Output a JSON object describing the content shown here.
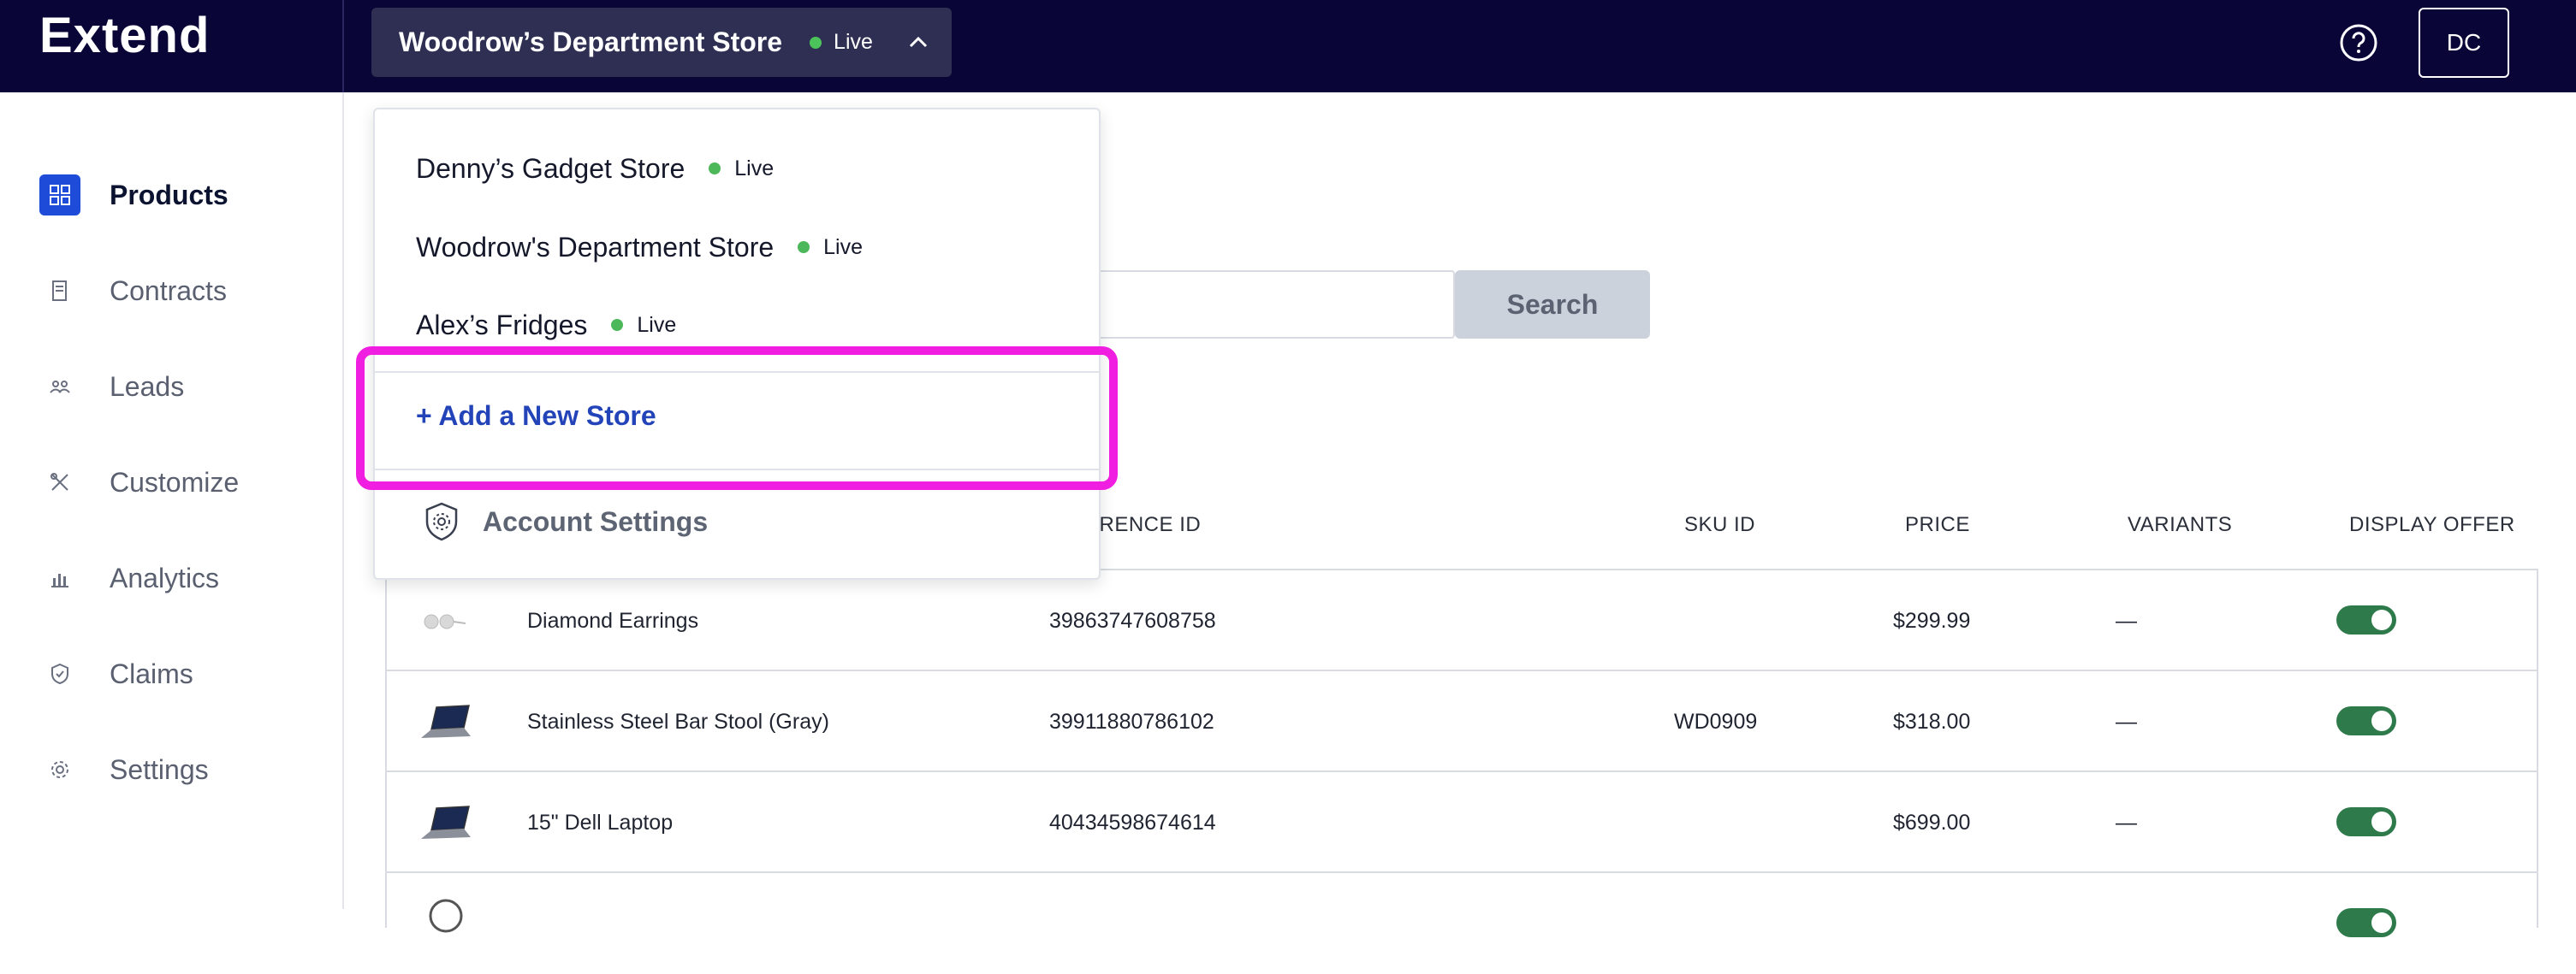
{
  "app": {
    "brand": "Extend"
  },
  "header": {
    "store_name": "Woodrow’s Department Store",
    "store_status": "Live",
    "user_initials": "DC"
  },
  "sidebar": {
    "items": [
      {
        "label": "Products",
        "icon": "grid-icon",
        "active": true
      },
      {
        "label": "Contracts",
        "icon": "receipt-icon"
      },
      {
        "label": "Leads",
        "icon": "users-icon"
      },
      {
        "label": "Customize",
        "icon": "tools-icon"
      },
      {
        "label": "Analytics",
        "icon": "bar-chart-icon"
      },
      {
        "label": "Claims",
        "icon": "shield-icon"
      },
      {
        "label": "Settings",
        "icon": "gear-icon"
      }
    ]
  },
  "search": {
    "button_label": "Search"
  },
  "table": {
    "headers": {
      "reference_id": "ERENCE ID",
      "sku_id": "SKU ID",
      "price": "PRICE",
      "variants": "VARIANTS",
      "display_offer": "DISPLAY OFFER"
    },
    "rows": [
      {
        "name": "Diamond Earrings",
        "reference_id": "39863747608758",
        "sku": "",
        "price": "$299.99",
        "variants": "—",
        "display_offer": true,
        "thumb": "earrings"
      },
      {
        "name": "Stainless Steel Bar Stool (Gray)",
        "reference_id": "39911880786102",
        "sku": "WD0909",
        "price": "$318.00",
        "variants": "—",
        "display_offer": true,
        "thumb": "laptop"
      },
      {
        "name": "15\" Dell Laptop",
        "reference_id": "40434598674614",
        "sku": "",
        "price": "$699.00",
        "variants": "—",
        "display_offer": true,
        "thumb": "laptop"
      }
    ]
  },
  "dropdown": {
    "stores": [
      {
        "name": "Denny’s Gadget Store",
        "status": "Live"
      },
      {
        "name": "Woodrow's Department Store",
        "status": "Live"
      },
      {
        "name": "Alex’s Fridges",
        "status": "Live"
      }
    ],
    "add_store_label": "+ Add a New Store",
    "account_settings_label": "Account Settings"
  },
  "colors": {
    "header_bg": "#090637",
    "accent": "#1e4bd8",
    "live": "#4cc35a",
    "toggle_on": "#2e7a4a",
    "highlight": "#f01ee0"
  }
}
